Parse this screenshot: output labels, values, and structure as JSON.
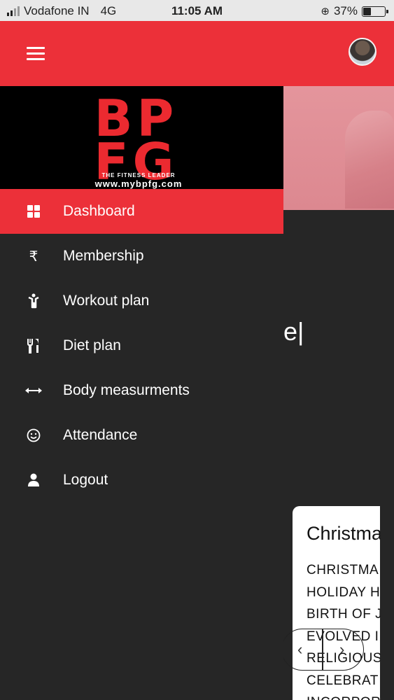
{
  "status_bar": {
    "carrier": "Vodafone IN",
    "network": "4G",
    "time": "11:05 AM",
    "battery": "37%",
    "battery_level": 0.37
  },
  "app_bar": {
    "menu_icon": "hamburger-icon",
    "avatar_icon": "profile-avatar"
  },
  "drawer": {
    "logo": {
      "line1": "BP",
      "line2": "FG",
      "tagline": "THE FITNESS LEADER",
      "url": "www.mybpfg.com"
    },
    "items": [
      {
        "label": "Dashboard",
        "icon": "dashboard-grid-icon",
        "active": true
      },
      {
        "label": "Membership",
        "icon": "rupee-icon",
        "active": false
      },
      {
        "label": "Workout plan",
        "icon": "person-workout-icon",
        "active": false
      },
      {
        "label": "Diet plan",
        "icon": "fork-knife-icon",
        "active": false
      },
      {
        "label": "Body measurments",
        "icon": "horizontal-arrows-icon",
        "active": false
      },
      {
        "label": "Attendance",
        "icon": "smiley-icon",
        "active": false
      },
      {
        "label": "Logout",
        "icon": "user-icon",
        "active": false
      }
    ]
  },
  "background": {
    "title_fragment": "e|",
    "card": {
      "title": "Christma",
      "lines": [
        "CHRISTMA",
        "HOLIDAY H",
        "BIRTH OF J",
        "EVOLVED I",
        "RELIGIOUS",
        "CELEBRAT",
        "INCORPOR"
      ]
    },
    "carousel": {
      "prev": "‹",
      "next": "›"
    }
  },
  "colors": {
    "accent": "#ec3039",
    "drawer_bg": "#262626",
    "logo_red": "#ec2a30"
  }
}
